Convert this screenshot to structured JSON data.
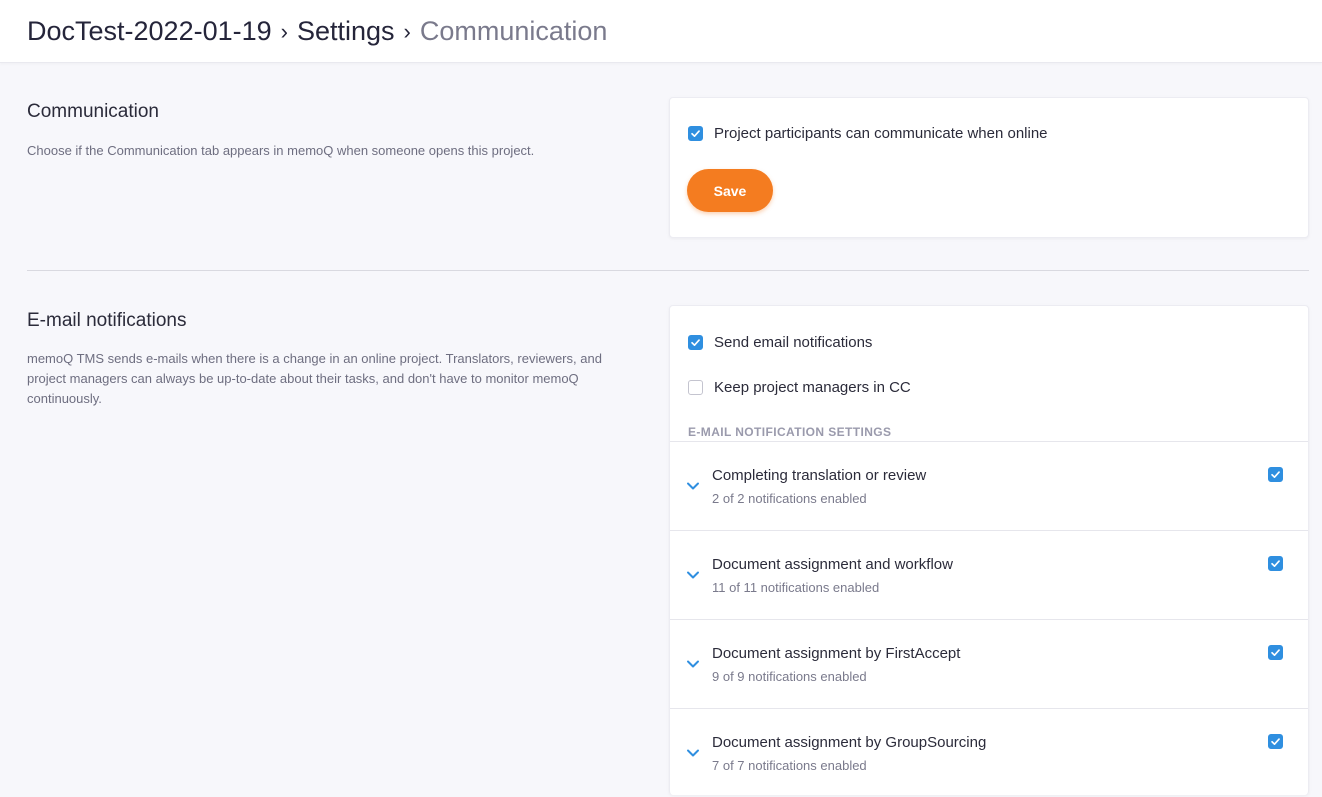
{
  "breadcrumb": {
    "project": "DocTest-2022-01-19",
    "settings": "Settings",
    "current": "Communication"
  },
  "communication": {
    "title": "Communication",
    "description": "Choose if the Communication tab appears in memoQ when someone opens this project.",
    "option_label": "Project participants can communicate when online",
    "option_checked": true,
    "save_label": "Save"
  },
  "email": {
    "title": "E-mail notifications",
    "description": "memoQ TMS sends e-mails when there is a change in an online project. Translators, reviewers, and project managers can always be up-to-date about their tasks, and don't have to monitor memoQ continuously.",
    "send_label": "Send email notifications",
    "send_checked": true,
    "cc_label": "Keep project managers in CC",
    "cc_checked": false,
    "settings_heading": "E-MAIL NOTIFICATION SETTINGS",
    "groups": [
      {
        "title": "Completing translation or review",
        "count": "2 of 2 notifications enabled",
        "checked": true
      },
      {
        "title": "Document assignment and workflow",
        "count": "11 of 11 notifications enabled",
        "checked": true
      },
      {
        "title": "Document assignment by FirstAccept",
        "count": "9 of 9 notifications enabled",
        "checked": true
      },
      {
        "title": "Document assignment by GroupSourcing",
        "count": "7 of 7 notifications enabled",
        "checked": true
      }
    ]
  },
  "colors": {
    "accent": "#f47c20",
    "checkbox": "#2f8fe0"
  }
}
